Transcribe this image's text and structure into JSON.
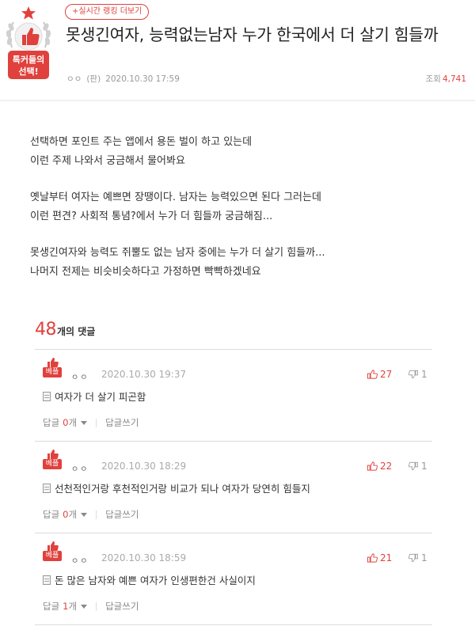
{
  "badge": {
    "text": "톡커들의 선택!",
    "line1": "톡커들의",
    "line2": "선택!",
    "icon": "thumbs-up-laurel-icon",
    "color": "#e0413c"
  },
  "header": {
    "ranking_link": "+실시간 랭킹 더보기",
    "title": "못생긴여자, 능력없는남자 누가 한국에서 더 살기 힘들까",
    "author": "ㅇㅇ",
    "board": "(판)",
    "date": "2020.10.30 17:59",
    "views_label": "조회",
    "views_count": "4,741"
  },
  "post": {
    "paragraphs": [
      [
        "선택하면 포인트 주는 앱에서 용돈 벌이 하고 있는데",
        "이런 주제 나와서 궁금해서 물어봐요"
      ],
      [
        "옛날부터 여자는 예쁘면 장땡이다. 남자는 능력있으면 된다 그러는데",
        "이런 편견? 사회적 통념?에서 누가 더 힘들까 궁금해짐..."
      ],
      [
        "못생긴여자와 능력도 쥐뿔도 없는 남자 중에는 누가 더 살기 힘들까...",
        "나머지 전제는 비슷비슷하다고 가정하면 빡빡하겠네요"
      ]
    ]
  },
  "comments": {
    "count": "48",
    "label": "개의 댓글",
    "items": [
      {
        "best": "베플",
        "author": "ㅇㅇ",
        "date": "2020.10.30 19:37",
        "up": "27",
        "down": "1",
        "text": "여자가 더 살기 피곤함",
        "reply_label": "답글",
        "reply_count": "0",
        "reply_unit": "개",
        "write_reply": "답글쓰기"
      },
      {
        "best": "베플",
        "author": "ㅇㅇ",
        "date": "2020.10.30 18:29",
        "up": "22",
        "down": "1",
        "text": "선천적인거랑 후천적인거랑 비교가 되나 여자가 당연히 힘들지",
        "reply_label": "답글",
        "reply_count": "0",
        "reply_unit": "개",
        "write_reply": "답글쓰기"
      },
      {
        "best": "베플",
        "author": "ㅇㅇ",
        "date": "2020.10.30 18:59",
        "up": "21",
        "down": "1",
        "text": "돈 많은 남자와 예쁜 여자가 인생편한건 사실이지",
        "reply_label": "답글",
        "reply_count": "1",
        "reply_unit": "개",
        "write_reply": "답글쓰기"
      }
    ]
  },
  "colors": {
    "accent": "#e0413c",
    "divider": "#dcdcdc",
    "muted": "#999999"
  }
}
